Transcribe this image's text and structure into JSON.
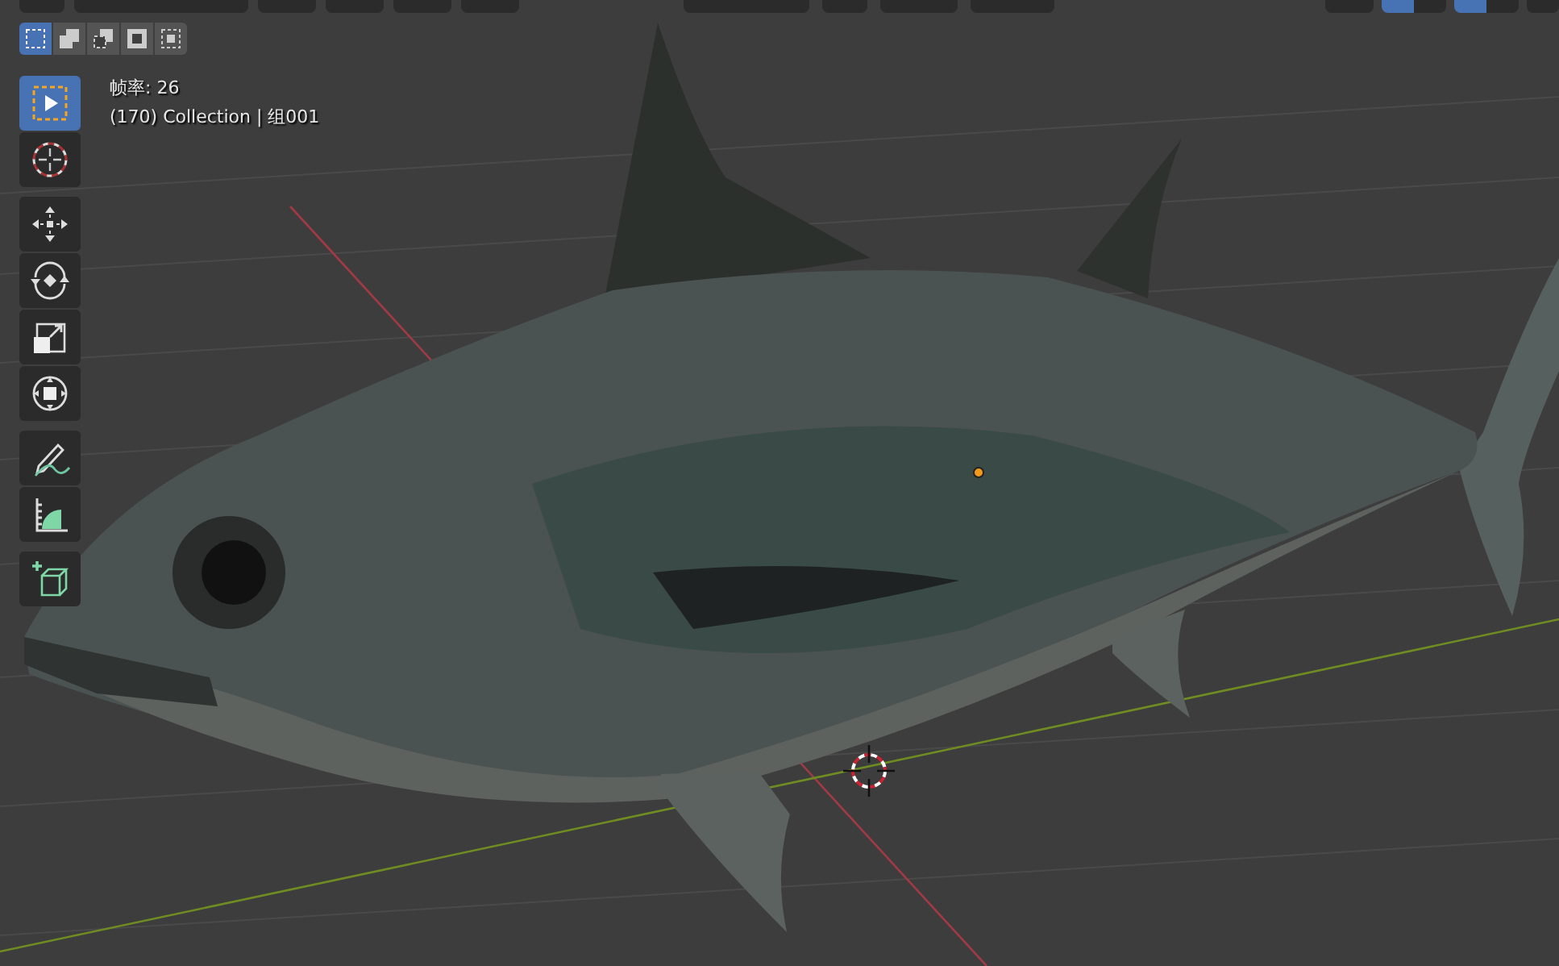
{
  "header": {
    "left_buttons": [
      {
        "kind": "editor"
      },
      {
        "kind": "mode"
      },
      {
        "kind": "menu"
      },
      {
        "kind": "menu"
      },
      {
        "kind": "menu"
      },
      {
        "kind": "menu"
      }
    ],
    "right_buttons": [
      {
        "kind": "orientation"
      },
      {
        "kind": "pivot"
      },
      {
        "kind": "snap"
      },
      {
        "kind": "proportional"
      }
    ],
    "far_right_buttons": [
      {
        "kind": "select"
      },
      {
        "kind": "gizmo",
        "selected": true
      },
      {
        "kind": "overlay",
        "selected": true
      },
      {
        "kind": "xray"
      }
    ]
  },
  "selection_modes": [
    {
      "kind": "new",
      "selected": true
    },
    {
      "kind": "extend",
      "selected": false
    },
    {
      "kind": "subtract",
      "selected": false
    },
    {
      "kind": "invert",
      "selected": false
    },
    {
      "kind": "intersect",
      "selected": false
    }
  ],
  "viewport_info": {
    "frame_rate": "帧率: 26",
    "object": "(170) Collection | 组001"
  },
  "tool_groups": [
    [
      {
        "kind": "select",
        "selected": true
      },
      {
        "kind": "cursor",
        "selected": false
      }
    ],
    [
      {
        "kind": "move",
        "selected": false
      },
      {
        "kind": "rotate",
        "selected": false
      },
      {
        "kind": "scale",
        "selected": false
      },
      {
        "kind": "transform",
        "selected": false
      }
    ],
    [
      {
        "kind": "annotate",
        "selected": false
      },
      {
        "kind": "measure",
        "selected": false
      }
    ],
    [
      {
        "kind": "add-cube",
        "selected": false
      }
    ]
  ]
}
